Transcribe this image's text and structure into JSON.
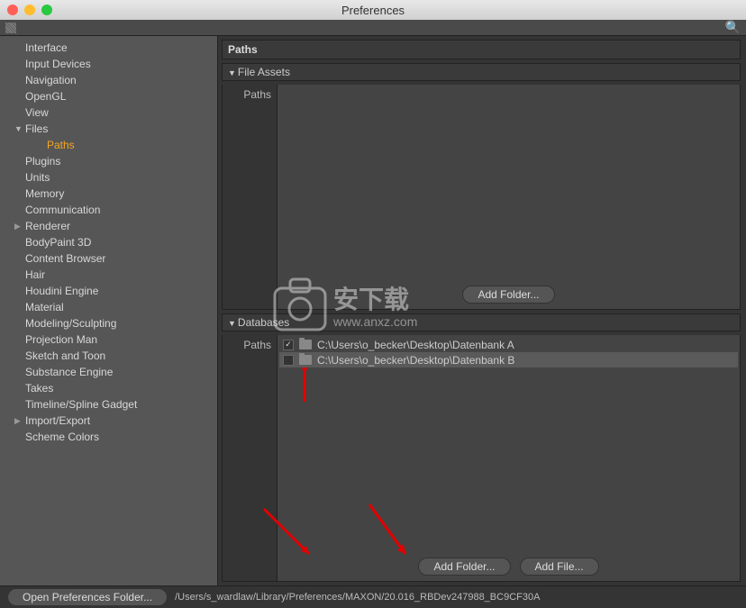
{
  "window": {
    "title": "Preferences"
  },
  "sidebar": {
    "items": [
      {
        "label": "Interface"
      },
      {
        "label": "Input Devices"
      },
      {
        "label": "Navigation"
      },
      {
        "label": "OpenGL"
      },
      {
        "label": "View"
      },
      {
        "label": "Files",
        "expanded": true
      },
      {
        "label": "Paths",
        "child": true,
        "selected": true
      },
      {
        "label": "Plugins"
      },
      {
        "label": "Units"
      },
      {
        "label": "Memory"
      },
      {
        "label": "Communication"
      },
      {
        "label": "Renderer",
        "expandable": true
      },
      {
        "label": "BodyPaint 3D"
      },
      {
        "label": "Content Browser"
      },
      {
        "label": "Hair"
      },
      {
        "label": "Houdini Engine"
      },
      {
        "label": "Material"
      },
      {
        "label": "Modeling/Sculpting"
      },
      {
        "label": "Projection Man"
      },
      {
        "label": "Sketch and Toon"
      },
      {
        "label": "Substance Engine"
      },
      {
        "label": "Takes"
      },
      {
        "label": "Timeline/Spline Gadget"
      },
      {
        "label": "Import/Export",
        "expandable": true
      },
      {
        "label": "Scheme Colors"
      }
    ]
  },
  "panel": {
    "title": "Paths",
    "file_assets": {
      "header": "File Assets",
      "paths_label": "Paths",
      "add_folder_btn": "Add Folder..."
    },
    "databases": {
      "header": "Databases",
      "paths_label": "Paths",
      "rows": [
        {
          "checked": true,
          "path": "C:\\Users\\o_becker\\Desktop\\Datenbank A"
        },
        {
          "checked": false,
          "path": "C:\\Users\\o_becker\\Desktop\\Datenbank B"
        }
      ],
      "add_folder_btn": "Add Folder...",
      "add_file_btn": "Add File..."
    }
  },
  "footer": {
    "open_btn": "Open Preferences Folder...",
    "path": "/Users/s_wardlaw/Library/Preferences/MAXON/20.016_RBDev247988_BC9CF30A"
  },
  "watermark": {
    "text": "安下载",
    "url": "www.anxz.com"
  }
}
